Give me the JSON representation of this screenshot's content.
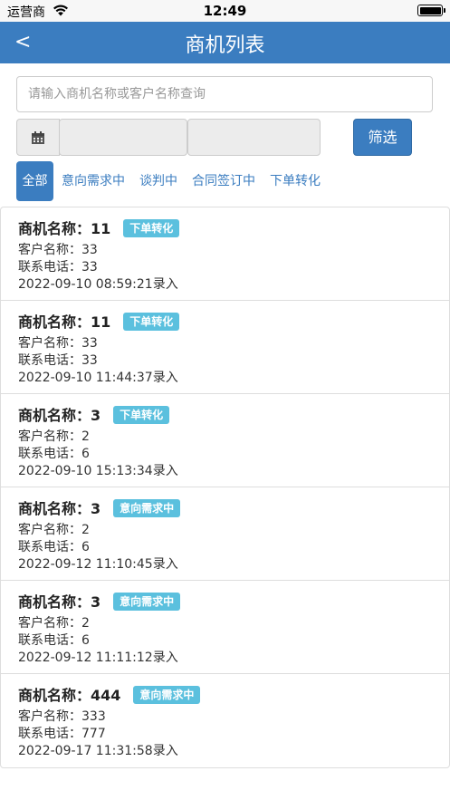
{
  "status_bar": {
    "carrier": "运营商",
    "time": "12:49"
  },
  "nav": {
    "back": "<",
    "title": "商机列表"
  },
  "search": {
    "placeholder": "请输入商机名称或客户名称查询",
    "value": ""
  },
  "date_filter": {
    "start": "",
    "end": ""
  },
  "filter_button": "筛选",
  "tabs": [
    "全部",
    "意向需求中",
    "谈判中",
    "合同签订中",
    "下单转化"
  ],
  "active_tab": "全部",
  "labels": {
    "title": "商机名称：",
    "customer": "客户名称：",
    "phone": "联系电话："
  },
  "items": [
    {
      "name": "11",
      "status": "下单转化",
      "customer": "33",
      "phone": "33",
      "time": "2022-09-10 08:59:21录入"
    },
    {
      "name": "11",
      "status": "下单转化",
      "customer": "33",
      "phone": "33",
      "time": "2022-09-10 11:44:37录入"
    },
    {
      "name": "3",
      "status": "下单转化",
      "customer": "2",
      "phone": "6",
      "time": "2022-09-10 15:13:34录入"
    },
    {
      "name": "3",
      "status": "意向需求中",
      "customer": "2",
      "phone": "6",
      "time": "2022-09-12 11:10:45录入"
    },
    {
      "name": "3",
      "status": "意向需求中",
      "customer": "2",
      "phone": "6",
      "time": "2022-09-12 11:11:12录入"
    },
    {
      "name": "444",
      "status": "意向需求中",
      "customer": "333",
      "phone": "777",
      "time": "2022-09-17 11:31:58录入"
    }
  ],
  "colors": {
    "primary": "#3b7dc0",
    "badge": "#5bc0de"
  },
  "icons": [
    "wifi-icon",
    "battery-icon",
    "calendar-icon"
  ]
}
